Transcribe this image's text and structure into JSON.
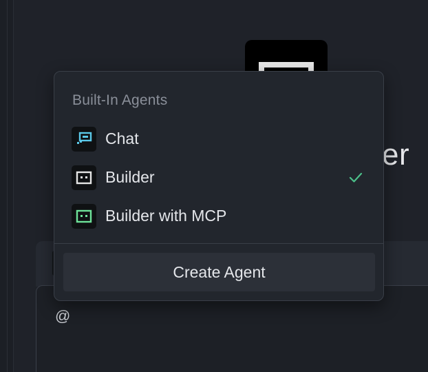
{
  "background": {
    "title_fragment": "der",
    "composer_prompt": "@"
  },
  "dropdown": {
    "section_label": "Built-In Agents",
    "items": [
      {
        "label": "Chat",
        "icon": "chat-agent-icon",
        "color": "#5bc8e8",
        "selected": false
      },
      {
        "label": "Builder",
        "icon": "builder-agent-icon",
        "color": "#e6e6e6",
        "selected": true
      },
      {
        "label": "Builder with MCP",
        "icon": "builder-mcp-agent-icon",
        "color": "#6ee39a",
        "selected": false
      }
    ],
    "check_color": "#4cc08a",
    "create_label": "Create Agent"
  }
}
